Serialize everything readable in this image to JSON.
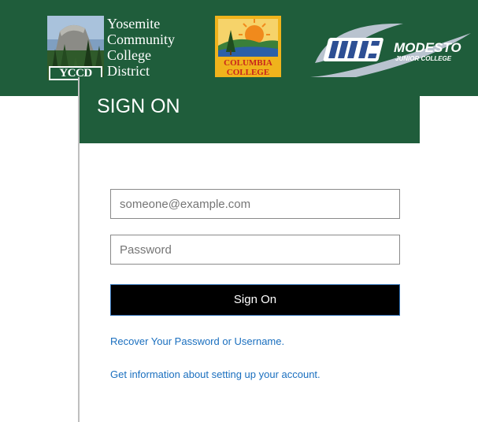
{
  "branding": {
    "yccd": {
      "lines": [
        "Yosemite",
        "Community",
        "College",
        "District"
      ],
      "badge": "YCCD"
    },
    "columbia": {
      "lines": [
        "COLUMBIA",
        "COLLEGE"
      ]
    },
    "mjc": {
      "name": "MODESTO",
      "sub": "JUNIOR COLLEGE"
    }
  },
  "signon": {
    "title": "SIGN ON",
    "email_placeholder": "someone@example.com",
    "password_placeholder": "Password",
    "submit_label": "Sign On",
    "recover_link": "Recover Your Password or Username.",
    "info_link": "Get information about setting up your account."
  },
  "colors": {
    "brand_green": "#1f5d3b",
    "button_bg": "#000000",
    "link": "#1a6fbf",
    "columbia_gold": "#f0b31c",
    "columbia_red": "#c8251c"
  }
}
